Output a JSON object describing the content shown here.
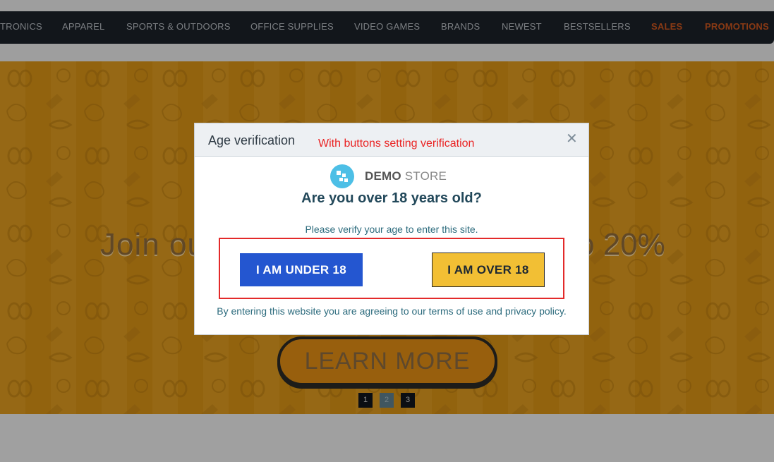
{
  "nav": {
    "items": [
      {
        "label": "TRONICS"
      },
      {
        "label": "APPAREL"
      },
      {
        "label": "SPORTS & OUTDOORS"
      },
      {
        "label": "OFFICE SUPPLIES"
      },
      {
        "label": "VIDEO GAMES"
      },
      {
        "label": "BRANDS"
      },
      {
        "label": "NEWEST"
      },
      {
        "label": "BESTSELLERS"
      },
      {
        "label": "SALES"
      },
      {
        "label": "PROMOTIONS"
      }
    ],
    "highlight_color": "#c9541e"
  },
  "banner": {
    "headline_left": "Join ou",
    "headline_right": "o 20%",
    "button_label": "LEARN MORE",
    "slides": [
      "1",
      "2",
      "3"
    ],
    "active_slide": "2"
  },
  "modal": {
    "title": "Age verification",
    "annotation": "With buttons setting verification",
    "close_icon": "close-icon",
    "logo": {
      "bold": "DEMO",
      "light": "STORE"
    },
    "question": "Are you over 18 years old?",
    "subtext": "Please verify your age to enter this site.",
    "under_button": "I AM UNDER 18",
    "over_button": "I AM OVER 18",
    "disclaimer": "By entering this website you are agreeing to our terms of use and privacy policy.",
    "colors": {
      "under": "#2456d0",
      "over": "#f2bf34",
      "annotation": "#ea2424"
    }
  }
}
